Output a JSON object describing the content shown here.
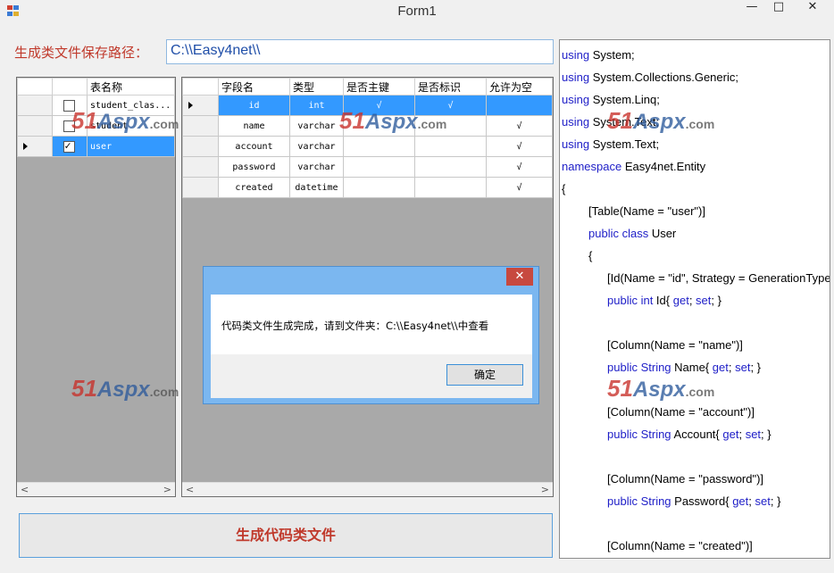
{
  "window": {
    "title": "Form1",
    "minimize_glyph": "—",
    "maximize_glyph": "□",
    "close_glyph": "✕"
  },
  "path": {
    "label": "生成类文件保存路径：",
    "value": "C:\\\\Easy4net\\\\"
  },
  "tables_grid": {
    "header": "表名称",
    "rows": [
      {
        "name": "student_clas...",
        "checked": false
      },
      {
        "name": "student",
        "checked": false
      },
      {
        "name": "user",
        "checked": true,
        "selected": true
      }
    ],
    "scroll_left": "<",
    "scroll_right": ">"
  },
  "fields_grid": {
    "headers": [
      "字段名",
      "类型",
      "是否主键",
      "是否标识",
      "允许为空"
    ],
    "rows": [
      {
        "name": "id",
        "type": "int",
        "pk": "√",
        "identity": "√",
        "nullable": "",
        "selected": true
      },
      {
        "name": "name",
        "type": "varchar",
        "pk": "",
        "identity": "",
        "nullable": "√"
      },
      {
        "name": "account",
        "type": "varchar",
        "pk": "",
        "identity": "",
        "nullable": "√"
      },
      {
        "name": "password",
        "type": "varchar",
        "pk": "",
        "identity": "",
        "nullable": "√"
      },
      {
        "name": "created",
        "type": "datetime",
        "pk": "",
        "identity": "",
        "nullable": "√"
      }
    ],
    "scroll_left": "<",
    "scroll_right": ">"
  },
  "code_lines": [
    {
      "indent": 0,
      "parts": [
        {
          "kw": "using"
        },
        {
          "t": " System;"
        }
      ]
    },
    {
      "indent": 0,
      "parts": [
        {
          "kw": "using"
        },
        {
          "t": " System.Collections.Generic;"
        }
      ]
    },
    {
      "indent": 0,
      "parts": [
        {
          "kw": "using"
        },
        {
          "t": " System.Linq;"
        }
      ]
    },
    {
      "indent": 0,
      "parts": [
        {
          "kw": "using"
        },
        {
          "t": " System.Text;"
        }
      ]
    },
    {
      "indent": 0,
      "parts": [
        {
          "kw": "using"
        },
        {
          "t": " System.Text;"
        }
      ]
    },
    {
      "indent": 0,
      "parts": [
        {
          "kw": "namespace"
        },
        {
          "t": " Easy4net.Entity"
        }
      ]
    },
    {
      "indent": 0,
      "parts": [
        {
          "t": "{"
        }
      ]
    },
    {
      "indent": 1,
      "parts": [
        {
          "t": "[Table(Name = \"user\")]"
        }
      ]
    },
    {
      "indent": 1,
      "parts": [
        {
          "kw": "public class"
        },
        {
          "t": " User"
        }
      ]
    },
    {
      "indent": 1,
      "parts": [
        {
          "t": "{"
        }
      ]
    },
    {
      "indent": 2,
      "parts": [
        {
          "t": "[Id(Name = \"id\", Strategy = GenerationType"
        }
      ]
    },
    {
      "indent": 2,
      "parts": [
        {
          "kw": "public int"
        },
        {
          "t": " Id{ "
        },
        {
          "kw": "get"
        },
        {
          "t": "; "
        },
        {
          "kw": "set"
        },
        {
          "t": "; }"
        }
      ]
    },
    {
      "indent": 0,
      "parts": []
    },
    {
      "indent": 2,
      "parts": [
        {
          "t": "[Column(Name = \"name\")]"
        }
      ]
    },
    {
      "indent": 2,
      "parts": [
        {
          "kw": "public String"
        },
        {
          "t": " Name{ "
        },
        {
          "kw": "get"
        },
        {
          "t": "; "
        },
        {
          "kw": "set"
        },
        {
          "t": "; }"
        }
      ]
    },
    {
      "indent": 0,
      "parts": []
    },
    {
      "indent": 2,
      "parts": [
        {
          "t": "[Column(Name = \"account\")]"
        }
      ]
    },
    {
      "indent": 2,
      "parts": [
        {
          "kw": "public String"
        },
        {
          "t": " Account{ "
        },
        {
          "kw": "get"
        },
        {
          "t": "; "
        },
        {
          "kw": "set"
        },
        {
          "t": "; }"
        }
      ]
    },
    {
      "indent": 0,
      "parts": []
    },
    {
      "indent": 2,
      "parts": [
        {
          "t": "[Column(Name = \"password\")]"
        }
      ]
    },
    {
      "indent": 2,
      "parts": [
        {
          "kw": "public String"
        },
        {
          "t": " Password{ "
        },
        {
          "kw": "get"
        },
        {
          "t": "; "
        },
        {
          "kw": "set"
        },
        {
          "t": "; }"
        }
      ]
    },
    {
      "indent": 0,
      "parts": []
    },
    {
      "indent": 2,
      "parts": [
        {
          "t": "[Column(Name = \"created\")]"
        }
      ]
    }
  ],
  "generate_button": "生成代码类文件",
  "dialog": {
    "close_glyph": "✕",
    "message": "代码类文件生成完成，请到文件夹：C:\\\\Easy4net\\\\中查看",
    "ok_label": "确定"
  },
  "watermark": {
    "num": "51",
    "aspx": "Aspx",
    "dom": ".com"
  },
  "colors": {
    "accent_red": "#c0392b",
    "selection": "#3399ff",
    "keyword": "#2020c8",
    "grid_bg": "#a9a9a9"
  }
}
